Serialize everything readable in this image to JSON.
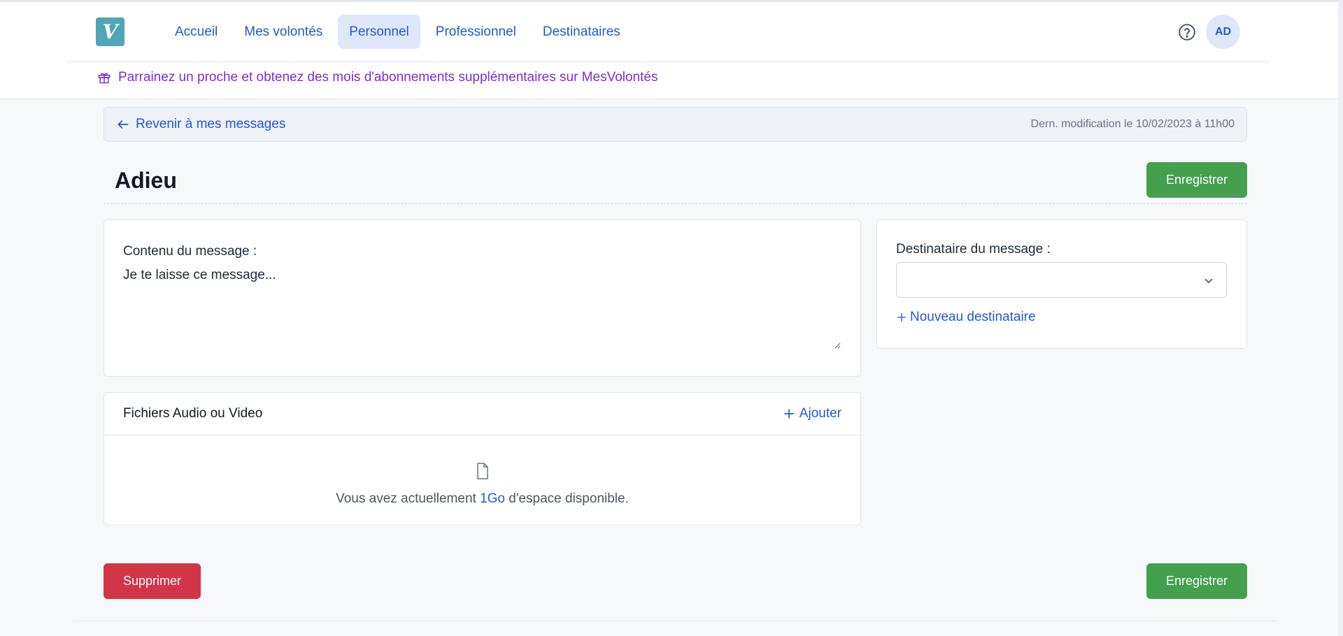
{
  "nav": {
    "logo_letter": "V",
    "items": [
      {
        "label": "Accueil",
        "active": false
      },
      {
        "label": "Mes volontés",
        "active": false
      },
      {
        "label": "Personnel",
        "active": true
      },
      {
        "label": "Professionnel",
        "active": false
      },
      {
        "label": "Destinataires",
        "active": false
      }
    ],
    "avatar_initials": "AD",
    "help_icon": "question-circle-icon"
  },
  "promo": {
    "text": "Parrainez un proche et obtenez des mois d'abonnements supplémentaires sur MesVolontés",
    "icon": "gift-icon"
  },
  "backbar": {
    "back_label": "Revenir à mes messages",
    "last_modified": "Dern. modification le 10/02/2023 à 11h00"
  },
  "page": {
    "title": "Adieu",
    "save_label": "Enregistrer",
    "delete_label": "Supprimer"
  },
  "message": {
    "label": "Contenu du message :",
    "value": "Je te laisse ce message..."
  },
  "files": {
    "title": "Fichiers Audio ou Video",
    "add_label": "Ajouter",
    "space_prefix": "Vous avez actuellement",
    "space_amount": "1Go",
    "space_suffix": "d'espace disponible."
  },
  "recipient": {
    "label": "Destinataire du message :",
    "selected": "",
    "new_label": "Nouveau destinataire"
  },
  "colors": {
    "accent": "#2557d6",
    "success": "#44a04d",
    "danger": "#d33548",
    "promo": "#7b2fd6"
  }
}
